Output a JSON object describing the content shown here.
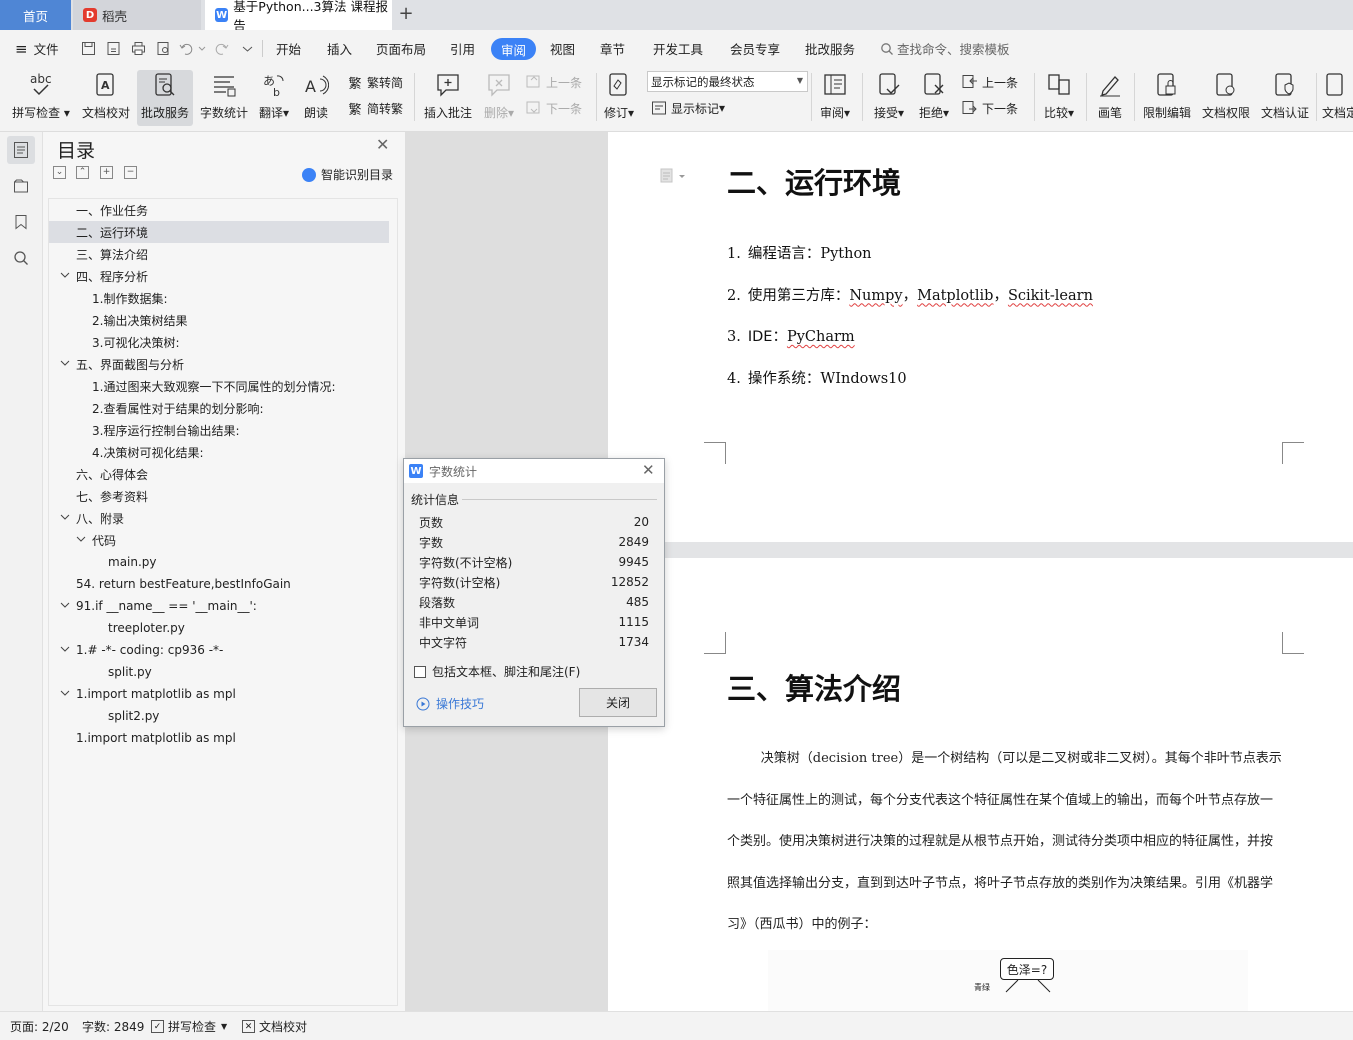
{
  "tabs": {
    "home": "首页",
    "daoke": "稻壳",
    "document": "基于Python...3算法 课程报告"
  },
  "menubar": {
    "file": "文件",
    "items": [
      "开始",
      "插入",
      "页面布局",
      "引用",
      "审阅",
      "视图",
      "章节",
      "开发工具",
      "会员专享",
      "批改服务"
    ],
    "active": "审阅",
    "search_placeholder": "查找命令、搜索模板"
  },
  "ribbon": {
    "spellcheck": "拼写检查",
    "doc_proof": "文档校对",
    "grading": "批改服务",
    "word_count": "字数统计",
    "translate": "翻译",
    "read_aloud": "朗读",
    "trad_to_simp": "繁转简",
    "simp_to_trad": "简转繁",
    "insert_comment": "插入批注",
    "delete": "删除",
    "prev_comment": "上一条",
    "next_comment": "下一条",
    "track_changes": "修订",
    "markup_state": "显示标记的最终状态",
    "show_markup": "显示标记",
    "review": "审阅",
    "accept": "接受",
    "reject": "拒绝",
    "prev_change": "上一条",
    "next_change": "下一条",
    "compare": "比较",
    "pen": "画笔",
    "restrict_edit": "限制编辑",
    "doc_permission": "文档权限",
    "doc_certify": "文档认证",
    "doc_last": "文档定"
  },
  "toc": {
    "title": "目录",
    "smart_button": "智能识别目录",
    "items": [
      {
        "text": "一、作业任务",
        "level": 0,
        "chevron": false,
        "selected": false
      },
      {
        "text": "二、运行环境",
        "level": 0,
        "chevron": false,
        "selected": true
      },
      {
        "text": "三、算法介绍",
        "level": 0,
        "chevron": false,
        "selected": false
      },
      {
        "text": "四、程序分析",
        "level": 0,
        "chevron": true,
        "selected": false
      },
      {
        "text": "1.制作数据集:",
        "level": 1,
        "chevron": false,
        "selected": false
      },
      {
        "text": "2.输出决策树结果",
        "level": 1,
        "chevron": false,
        "selected": false
      },
      {
        "text": "3.可视化决策树:",
        "level": 1,
        "chevron": false,
        "selected": false
      },
      {
        "text": "五、界面截图与分析",
        "level": 0,
        "chevron": true,
        "selected": false
      },
      {
        "text": "1.通过图来大致观察一下不同属性的划分情况:",
        "level": 1,
        "chevron": false,
        "selected": false
      },
      {
        "text": "2.查看属性对于结果的划分影响:",
        "level": 1,
        "chevron": false,
        "selected": false
      },
      {
        "text": "3.程序运行控制台输出结果:",
        "level": 1,
        "chevron": false,
        "selected": false
      },
      {
        "text": "4.决策树可视化结果:",
        "level": 1,
        "chevron": false,
        "selected": false
      },
      {
        "text": "六、心得体会",
        "level": 0,
        "chevron": false,
        "selected": false
      },
      {
        "text": "七、参考资料",
        "level": 0,
        "chevron": false,
        "selected": false
      },
      {
        "text": "八、附录",
        "level": 0,
        "chevron": true,
        "selected": false
      },
      {
        "text": "代码",
        "level": 1,
        "chevron": true,
        "selected": false
      },
      {
        "text": "main.py",
        "level": 2,
        "chevron": false,
        "selected": false
      },
      {
        "text": "54.     return bestFeature,bestInfoGain",
        "level": 0,
        "chevron": false,
        "selected": false
      },
      {
        "text": "91.if __name__ == '__main__':",
        "level": 0,
        "chevron": true,
        "selected": false
      },
      {
        "text": "treeploter.py",
        "level": 2,
        "chevron": false,
        "selected": false
      },
      {
        "text": "1.# -*- coding: cp936 -*-",
        "level": 0,
        "chevron": true,
        "selected": false
      },
      {
        "text": "split.py",
        "level": 2,
        "chevron": false,
        "selected": false
      },
      {
        "text": "1.import matplotlib as mpl",
        "level": 0,
        "chevron": true,
        "selected": false
      },
      {
        "text": "split2.py",
        "level": 2,
        "chevron": false,
        "selected": false
      },
      {
        "text": "1.import matplotlib as mpl",
        "level": 0,
        "chevron": false,
        "selected": false
      }
    ]
  },
  "document": {
    "section2_heading": "二、运行环境",
    "section2_items": [
      {
        "num": "1.",
        "prefix": "编程语言：",
        "parts": [
          {
            "t": "Python",
            "sq": false
          }
        ]
      },
      {
        "num": "2.",
        "prefix": "使用第三方库：",
        "parts": [
          {
            "t": "Numpy",
            "sq": true
          },
          {
            "t": "，",
            "sq": false
          },
          {
            "t": "Matplotlib",
            "sq": true
          },
          {
            "t": "，",
            "sq": false
          },
          {
            "t": "Scikit-learn",
            "sq": true
          }
        ]
      },
      {
        "num": "3.",
        "prefix": "IDE：",
        "parts": [
          {
            "t": "PyCharm",
            "sq": true
          }
        ]
      },
      {
        "num": "4.",
        "prefix": "操作系统：",
        "parts": [
          {
            "t": "WIndows10",
            "sq": false
          }
        ]
      }
    ],
    "section3_heading": "三、算法介绍",
    "section3_paragraph": "决策树（decision tree）是一个树结构（可以是二叉树或非二叉树）。其每个非叶节点表示一个特征属性上的测试，每个分支代表这个特征属性在某个值域上的输出，而每个叶节点存放一个类别。使用决策树进行决策的过程就是从根节点开始，测试待分类项中相应的特征属性，并按照其值选择输出分支，直到到达叶子节点，将叶子节点存放的类别作为决策结果。引用《机器学习》（西瓜书）中的例子：",
    "figure_root_label": "色泽=?",
    "figure_branch_label": "青绿"
  },
  "dialog": {
    "title": "字数统计",
    "section": "统计信息",
    "rows": [
      {
        "label": "页数",
        "value": "20"
      },
      {
        "label": "字数",
        "value": "2849"
      },
      {
        "label": "字符数(不计空格)",
        "value": "9945"
      },
      {
        "label": "字符数(计空格)",
        "value": "12852"
      },
      {
        "label": "段落数",
        "value": "485"
      },
      {
        "label": "非中文单词",
        "value": "1115"
      },
      {
        "label": "中文字符",
        "value": "1734"
      }
    ],
    "include_checkbox": "包括文本框、脚注和尾注(F)",
    "tips_link": "操作技巧",
    "close_button": "关闭"
  },
  "statusbar": {
    "page": "页面: 2/20",
    "words": "字数: 2849",
    "spellcheck": "拼写检查",
    "doc_proof": "文档校对"
  },
  "colors": {
    "accent": "#3b82f6",
    "home_tab": "#4f86d5",
    "link": "#3978d6",
    "spell_squiggle": "#e04040"
  }
}
